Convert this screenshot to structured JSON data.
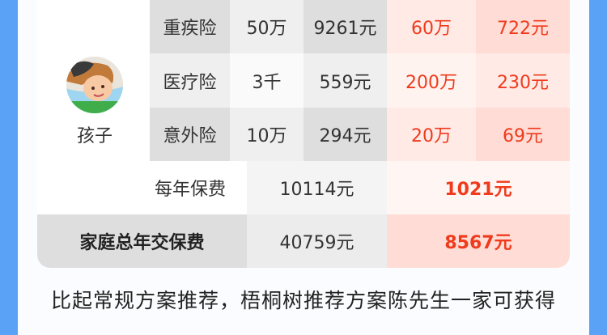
{
  "person": {
    "name": "孩子"
  },
  "rows": [
    {
      "label": "重疾险",
      "c1": "50万",
      "c2": "9261元",
      "c3": "60万",
      "c4": "722元"
    },
    {
      "label": "医疗险",
      "c1": "3千",
      "c2": "559元",
      "c3": "200万",
      "c4": "230元"
    },
    {
      "label": "意外险",
      "c1": "10万",
      "c2": "294元",
      "c3": "20万",
      "c4": "69元"
    }
  ],
  "annual": {
    "label": "每年保费",
    "regular": "10114元",
    "recommended": "1021元"
  },
  "family_total": {
    "label": "家庭总年交保费",
    "regular": "40759元",
    "recommended": "8567元"
  },
  "footer": {
    "text": "比起常规方案推荐，梧桐树推荐方案陈先生一家可获得"
  },
  "colors": {
    "accent_red": "#f03a1c",
    "frame_blue": "#5aa2f5",
    "pink_light": "#ffeae6",
    "pink_dark": "#ffdcd5"
  }
}
